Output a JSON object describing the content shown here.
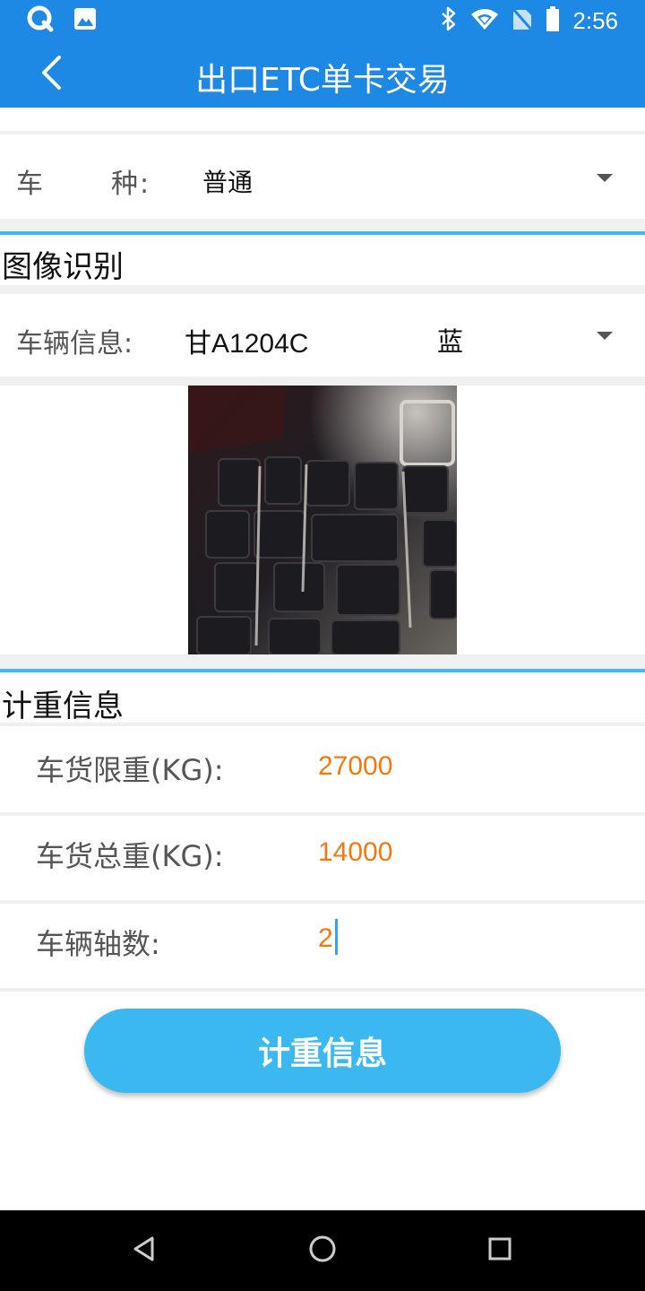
{
  "status_bar": {
    "time": "2:56",
    "left_icons": [
      "quickq-app-icon",
      "gallery-icon"
    ],
    "right_icons": [
      "bluetooth-icon",
      "wifi-icon",
      "no-sim-icon",
      "battery-icon"
    ]
  },
  "header": {
    "title": "出口ETC单卡交易",
    "back_icon": "chevron-left-icon"
  },
  "vehicle_type": {
    "label_part1": "车",
    "label_part2": "种:",
    "value": "普通"
  },
  "image_recognition": {
    "section_title": "图像识别",
    "vehicle_info_label": "车辆信息:",
    "plate": "甘A1204C",
    "plate_color": "蓝"
  },
  "weighing": {
    "section_title": "计重信息",
    "limit_label": "车货限重(KG):",
    "limit_value": "27000",
    "total_label": "车货总重(KG):",
    "total_value": "14000",
    "axles_label": "车辆轴数:",
    "axles_value": "2"
  },
  "submit_button": "计重信息",
  "nav_bar": [
    "back-triangle-icon",
    "home-circle-icon",
    "recents-square-icon"
  ],
  "colors": {
    "primary": "#1e88e5",
    "accent_line": "#43b6ef",
    "button": "#3bb8f0",
    "value_orange": "#f07a12"
  }
}
